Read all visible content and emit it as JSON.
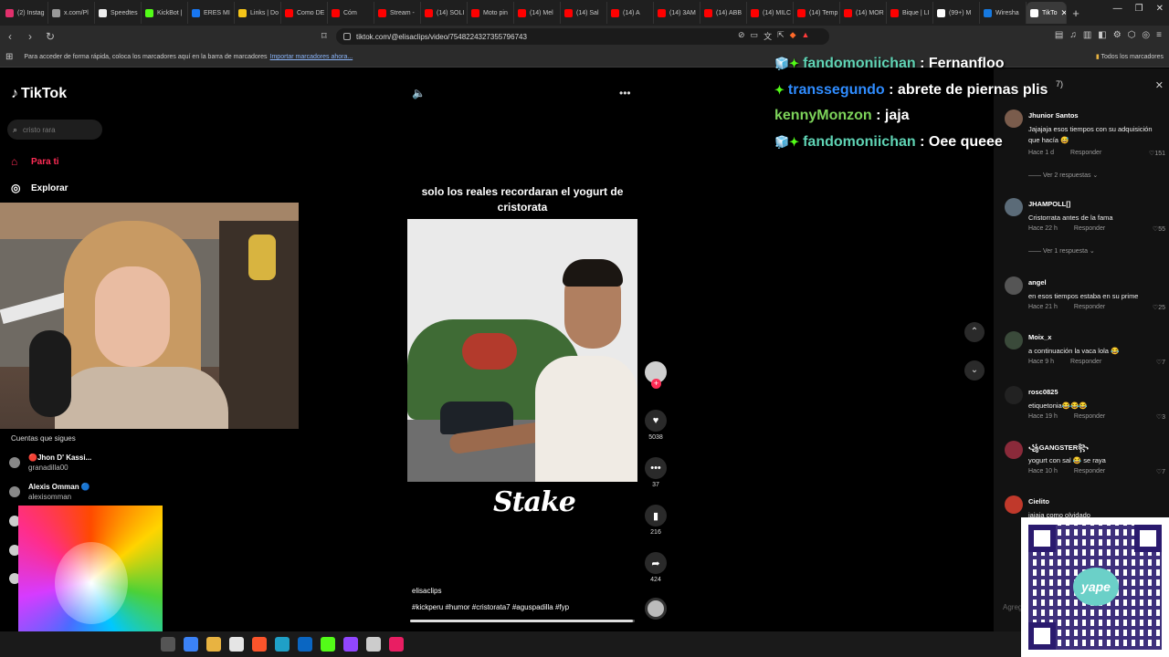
{
  "browser": {
    "tabs": [
      {
        "label": "(2) Instag",
        "color": "#e1306c"
      },
      {
        "label": "x.com/Pl",
        "color": "#999999"
      },
      {
        "label": "Speedtes",
        "color": "#eeeeee"
      },
      {
        "label": "KickBot |",
        "color": "#53fc18"
      },
      {
        "label": "ERES MI",
        "color": "#1877f2"
      },
      {
        "label": "Links | Do",
        "color": "#f5c518"
      },
      {
        "label": "Como DE",
        "color": "#ff0000"
      },
      {
        "label": "Cóm",
        "color": "#ff0000"
      },
      {
        "label": "Stream -",
        "color": "#ff0000"
      },
      {
        "label": "(14) SOLI",
        "color": "#ff0000"
      },
      {
        "label": "Moto pin",
        "color": "#ff0000"
      },
      {
        "label": "(14) Mel",
        "color": "#ff0000"
      },
      {
        "label": "(14) Sal",
        "color": "#ff0000"
      },
      {
        "label": "(14) A",
        "color": "#ff0000"
      },
      {
        "label": "(14) 3AM",
        "color": "#ff0000"
      },
      {
        "label": "(14) ABB",
        "color": "#ff0000"
      },
      {
        "label": "(14) MILC",
        "color": "#ff0000"
      },
      {
        "label": "(14) Temp",
        "color": "#ff0000"
      },
      {
        "label": "(14) MOR",
        "color": "#ff0000"
      },
      {
        "label": "Bique | LI",
        "color": "#ff0000"
      },
      {
        "label": "(99+) M",
        "color": "#ffffff"
      },
      {
        "label": "Wiresha",
        "color": "#1679e0"
      },
      {
        "label": "TikTo",
        "color": "#ffffff"
      }
    ],
    "url": "tiktok.com/@elisaclips/video/7548224327355796743",
    "bookmarks_prompt": "Para acceder de forma rápida, coloca los marcadores aquí en la barra de marcadores",
    "bookmarks_link": "Importar marcadores ahora...",
    "all_bookmarks": "Todos los marcadores"
  },
  "sidebar": {
    "brand": "TikTok",
    "search_placeholder": "cristo rara",
    "nav": [
      {
        "label": "Para ti"
      },
      {
        "label": "Explorar"
      }
    ],
    "following_title": "Cuentas que sigues",
    "following": [
      {
        "name": "🔴Jhon D' Kassi...",
        "handle": "granadilla00"
      },
      {
        "name": "Alexis Omman 🔵",
        "handle": "alexisomman"
      }
    ]
  },
  "video": {
    "caption_top": "solo los reales recordaran el yogurt de cristorata",
    "overlay_logo": "Stake",
    "author": "elisaclips",
    "tags": "#kickperu #humor #cristorata7 #aguspadilla #fyp",
    "progress": 0.99,
    "likes": "5038",
    "comments": "37",
    "saves": "216",
    "shares": "424"
  },
  "chat": [
    {
      "user": "fandomoniichan",
      "user_color": "#5fd3b4",
      "badges": "🧊✦",
      "message": "Fernanfloo"
    },
    {
      "user": "transsegundo",
      "user_color": "#2f8cff",
      "badges": "✦",
      "message": "abrete de piernas plis"
    },
    {
      "user": "kennyMonzon",
      "user_color": "#7dd35a",
      "badges": "",
      "message": "jaja"
    },
    {
      "user": "fandomoniichan",
      "user_color": "#5fd3b4",
      "badges": "🧊✦",
      "message": "Oee queee"
    }
  ],
  "comments": {
    "count_fragment": "7)",
    "items": [
      {
        "user": "Jhunior Santos",
        "text": "Jajajaja esos tiempos con su adquisición que hacía 😅",
        "time": "Hace 1 d",
        "reply": "Responder",
        "likes": "151",
        "replies": "Ver 2 respuestas ⌄"
      },
      {
        "user": "JHAMPOLL[]",
        "text": "Cristorrata antes de la fama",
        "time": "Hace 22 h",
        "reply": "Responder",
        "likes": "55",
        "replies": "Ver 1 respuesta ⌄"
      },
      {
        "user": "angel",
        "text": "en esos tiempos estaba en su prime",
        "time": "Hace 21 h",
        "reply": "Responder",
        "likes": "25",
        "replies": ""
      },
      {
        "user": "Moix_x",
        "text": "a continuación la vaca lola 😂",
        "time": "Hace 9 h",
        "reply": "Responder",
        "likes": "7",
        "replies": ""
      },
      {
        "user": "rosc0825",
        "text": "etiquetonia😂😂😂",
        "time": "Hace 19 h",
        "reply": "Responder",
        "likes": "3",
        "replies": ""
      },
      {
        "user": "꧁GANGSTER꧂",
        "text": "yogurt con sal 😂 se raya",
        "time": "Hace 10 h",
        "reply": "Responder",
        "likes": "7",
        "replies": ""
      },
      {
        "user": "Cielito",
        "text": "jajaja como olvidado",
        "time": "",
        "reply": "",
        "likes": "",
        "replies": ""
      }
    ],
    "input_placeholder": "Agreg"
  },
  "qr": {
    "brand": "yape"
  },
  "colors": {
    "tiktok_red": "#fe2c55",
    "comment_bg": "#121212"
  }
}
